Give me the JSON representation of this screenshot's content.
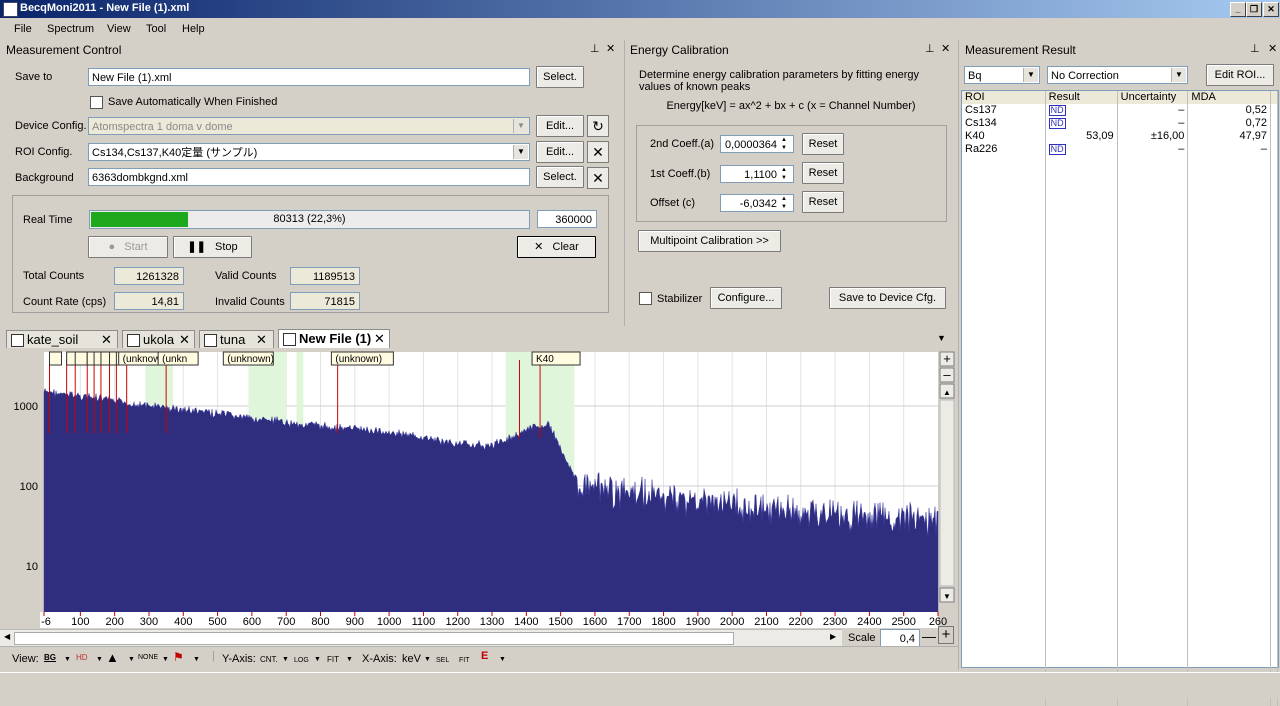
{
  "window": {
    "title": "BecqMoni2011 - New File (1).xml"
  },
  "menu": [
    "File",
    "Spectrum",
    "View",
    "Tool",
    "Help"
  ],
  "measurement_control": {
    "title": "Measurement Control",
    "save_to_label": "Save to",
    "save_to_value": "New File (1).xml",
    "select_label": "Select.",
    "auto_save_label": "Save Automatically When Finished",
    "device_config_label": "Device Config.",
    "device_config_value": "Atomspectra 1 doma v dome",
    "edit_label": "Edit...",
    "roi_config_label": "ROI Config.",
    "roi_config_value": "Cs134,Cs137,K40定量 (サンプル)",
    "background_label": "Background",
    "background_value": "6363dombkgnd.xml",
    "real_time_label": "Real Time",
    "progress_text": "80313 (22,3%)",
    "progress_fraction": 0.223,
    "real_time_target": "360000",
    "start_label": "Start",
    "stop_label": "Stop",
    "clear_label": "Clear",
    "total_counts_label": "Total Counts",
    "total_counts": "1261328",
    "valid_counts_label": "Valid Counts",
    "valid_counts": "1189513",
    "count_rate_label": "Count Rate (cps)",
    "count_rate": "14,81",
    "invalid_counts_label": "Invalid Counts",
    "invalid_counts": "71815"
  },
  "energy_calibration": {
    "title": "Energy Calibration",
    "description": "Determine energy calibration parameters by fitting energy values of known peaks",
    "formula": "Energy[keV] = ax^2 + bx + c  (x = Channel Number)",
    "coeff_a_label": "2nd Coeff.(a)",
    "coeff_a": "0,0000364",
    "coeff_b_label": "1st Coeff.(b)",
    "coeff_b": "1,1100",
    "coeff_c_label": "Offset (c)",
    "coeff_c": "-6,0342",
    "reset_label": "Reset",
    "multipoint_label": "Multipoint Calibration >>",
    "stabilizer_label": "Stabilizer",
    "configure_label": "Configure...",
    "save_device_label": "Save to Device Cfg."
  },
  "measurement_result": {
    "title": "Measurement Result",
    "unit": "Bq",
    "correction": "No Correction",
    "edit_roi_label": "Edit ROI...",
    "columns": [
      "ROI",
      "Result",
      "Uncertainty",
      "MDA"
    ],
    "rows": [
      {
        "roi": "Cs137",
        "result": "ND",
        "uncertainty": "–",
        "mda": "0,52"
      },
      {
        "roi": "Cs134",
        "result": "ND",
        "uncertainty": "–",
        "mda": "0,72"
      },
      {
        "roi": "K40",
        "result": "53,09",
        "uncertainty": "±16,00",
        "mda": "47,97"
      },
      {
        "roi": "Ra226",
        "result": "ND",
        "uncertainty": "–",
        "mda": "–"
      }
    ]
  },
  "tabs": [
    {
      "label": "kate_soil",
      "active": false
    },
    {
      "label": "ukola",
      "active": false
    },
    {
      "label": "tuna",
      "active": false
    },
    {
      "label": "New File (1)",
      "active": true
    }
  ],
  "spectrum": {
    "y_ticks": [
      "1000",
      "100",
      "10"
    ],
    "x_ticks": [
      "-6",
      "100",
      "200",
      "300",
      "400",
      "500",
      "600",
      "700",
      "800",
      "900",
      "1000",
      "1100",
      "1200",
      "1300",
      "1400",
      "1500",
      "1600",
      "1700",
      "1800",
      "1900",
      "2000",
      "2100",
      "2200",
      "2300",
      "2400",
      "2500",
      "260"
    ],
    "peak_labels": [
      "(unknown)",
      "(unkn",
      "(unknown)",
      "(unknown)",
      "K40"
    ],
    "scale_label": "Scale",
    "scale_value": "0,4"
  },
  "chart_data": {
    "type": "area",
    "title": "",
    "xlabel": "keV",
    "ylabel": "CNT.",
    "yscale": "log",
    "x_range": [
      -6,
      2600
    ],
    "y_range": [
      1,
      5000
    ],
    "x": [
      0,
      50,
      100,
      150,
      200,
      300,
      400,
      500,
      600,
      700,
      800,
      900,
      1000,
      1100,
      1200,
      1300,
      1350,
      1400,
      1460,
      1480,
      1500,
      1550,
      1600,
      1700,
      1800,
      1900,
      2000,
      2100,
      2200,
      2300,
      2400,
      2500,
      2600
    ],
    "y": [
      1500,
      1400,
      1350,
      1250,
      1150,
      1000,
      900,
      800,
      700,
      620,
      560,
      520,
      470,
      400,
      340,
      320,
      400,
      500,
      600,
      450,
      300,
      110,
      90,
      80,
      72,
      65,
      58,
      52,
      48,
      44,
      40,
      38,
      36
    ],
    "grid": true,
    "legend": "none"
  },
  "bottom_toolbar": {
    "view_label": "View:",
    "bg_label": "BG",
    "hd_label": "HD",
    "none_label": "NONE",
    "y_axis_label": "Y-Axis:",
    "cnt_label": "CNT.",
    "log_label": "LOG",
    "fit_label": "FIT",
    "x_axis_label": "X-Axis:",
    "kev_label": "keV",
    "sel_label": "SEL",
    "e_label": "E"
  }
}
